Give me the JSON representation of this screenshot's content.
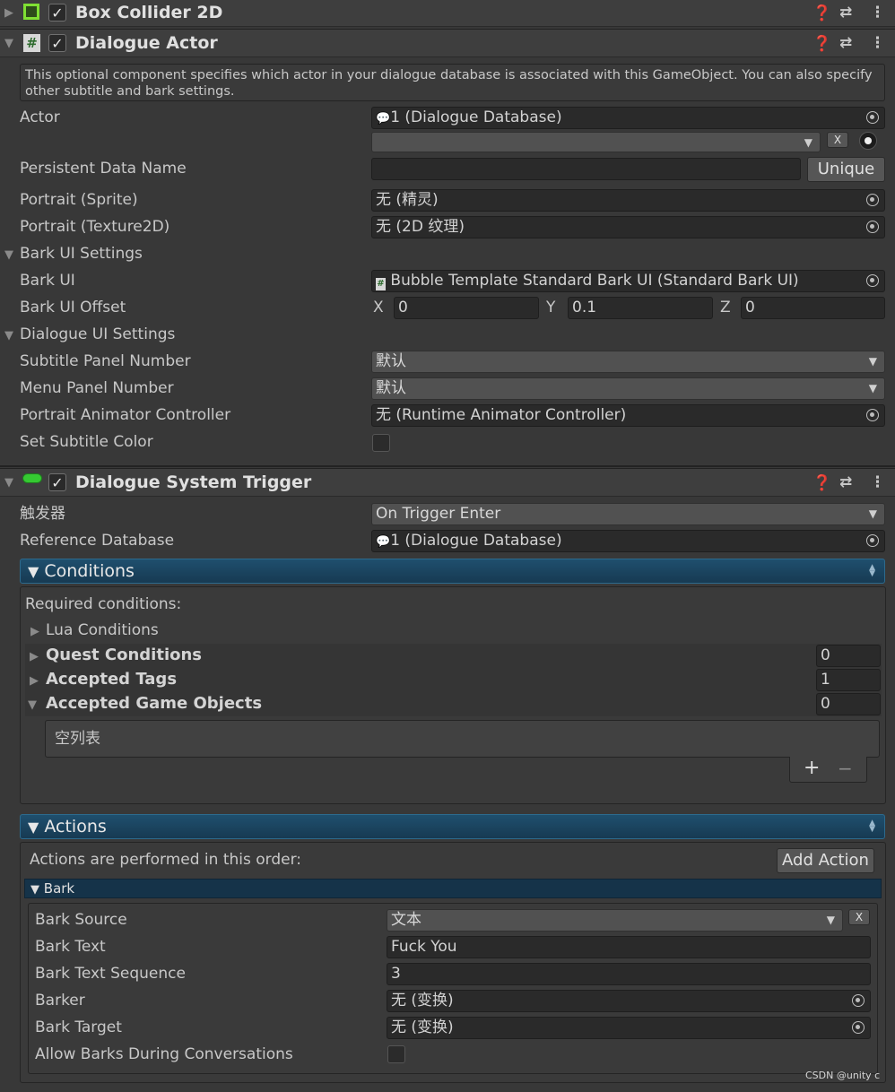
{
  "box_collider": {
    "title": "Box Collider 2D"
  },
  "dialogue_actor": {
    "title": "Dialogue Actor",
    "help": "This optional component specifies which actor in your dialogue database is associated with this GameObject. You can also specify other subtitle and bark settings.",
    "actor": {
      "label": "Actor",
      "value": "1 (Dialogue Database)",
      "selected": "",
      "clear": "X"
    },
    "persistent": {
      "label": "Persistent Data Name",
      "value": "",
      "button": "Unique"
    },
    "portrait_sprite": {
      "label": "Portrait (Sprite)",
      "value": "无 (精灵)"
    },
    "portrait_texture": {
      "label": "Portrait (Texture2D)",
      "value": "无 (2D 纹理)"
    },
    "bark_settings": {
      "title": "Bark UI Settings",
      "bark_ui": {
        "label": "Bark UI",
        "value": "Bubble Template Standard Bark UI (Standard Bark UI)"
      },
      "offset": {
        "label": "Bark UI Offset",
        "x_label": "X",
        "x": "0",
        "y_label": "Y",
        "y": "0.1",
        "z_label": "Z",
        "z": "0"
      }
    },
    "dialogue_ui_settings": {
      "title": "Dialogue UI Settings",
      "subtitle_panel": {
        "label": "Subtitle Panel Number",
        "value": "默认"
      },
      "menu_panel": {
        "label": "Menu Panel Number",
        "value": "默认"
      },
      "portrait_animator": {
        "label": "Portrait Animator Controller",
        "value": "无 (Runtime Animator Controller)"
      },
      "subtitle_color": {
        "label": "Set Subtitle Color",
        "checked": false
      }
    }
  },
  "trigger": {
    "title": "Dialogue System Trigger",
    "trigger": {
      "label": "触发器",
      "value": "On Trigger Enter"
    },
    "reference_db": {
      "label": "Reference Database",
      "value": "1 (Dialogue Database)"
    },
    "conditions": {
      "title": "Conditions",
      "required": "Required conditions:",
      "lua": "Lua Conditions",
      "quest": {
        "label": "Quest Conditions",
        "count": "0"
      },
      "tags": {
        "label": "Accepted Tags",
        "count": "1"
      },
      "game_objects": {
        "label": "Accepted Game Objects",
        "count": "0"
      },
      "empty_list": "空列表",
      "add": "+",
      "remove": "−"
    },
    "actions": {
      "title": "Actions",
      "order_text": "Actions are performed in this order:",
      "add_action": "Add Action",
      "bark": {
        "title": "Bark",
        "source": {
          "label": "Bark Source",
          "value": "文本",
          "clear": "X"
        },
        "text": {
          "label": "Bark Text",
          "value": "Fuck You"
        },
        "sequence": {
          "label": "Bark Text Sequence",
          "value": "3"
        },
        "barker": {
          "label": "Barker",
          "value": "无 (变换)"
        },
        "target": {
          "label": "Bark Target",
          "value": "无 (变换)"
        },
        "allow": {
          "label": "Allow Barks During Conversations",
          "checked": false
        }
      }
    }
  },
  "watermark": "CSDN @unity c",
  "colors": {
    "panel_bg": "#383838",
    "field_bg": "#2a2a2a",
    "accent_blue": "#1f4f6e",
    "collider_green": "#7fe033",
    "trigger_green": "#35c932"
  },
  "icons": {
    "foldout": "triangle-icon",
    "collider": "box-collider-icon",
    "script": "script-hash-icon",
    "trigger": "trigger-pill-icon",
    "help": "help-icon",
    "presets": "presets-icon",
    "menu": "kebab-menu-icon",
    "object_picker": "object-picker-icon",
    "database": "database-icon"
  }
}
